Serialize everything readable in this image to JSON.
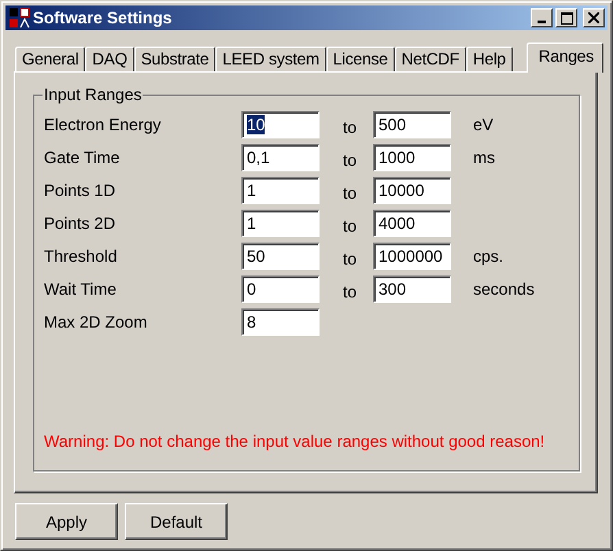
{
  "window": {
    "title": "Software Settings"
  },
  "tabs": [
    {
      "label": "General",
      "selected": false
    },
    {
      "label": "DAQ",
      "selected": false
    },
    {
      "label": "Substrate",
      "selected": false
    },
    {
      "label": "LEED system",
      "selected": false
    },
    {
      "label": "License",
      "selected": false
    },
    {
      "label": "NetCDF",
      "selected": false
    },
    {
      "label": "Help",
      "selected": false
    },
    {
      "label": "Ranges",
      "selected": true
    }
  ],
  "group": {
    "title": "Input Ranges",
    "rows": [
      {
        "label": "Electron Energy",
        "min": "10",
        "min_focused": true,
        "to": "to",
        "max": "500",
        "unit": "eV"
      },
      {
        "label": "Gate Time",
        "min": "0,1",
        "min_focused": false,
        "to": "to",
        "max": "1000",
        "unit": "ms"
      },
      {
        "label": "Points 1D",
        "min": "1",
        "min_focused": false,
        "to": "to",
        "max": "10000"
      },
      {
        "label": "Points 2D",
        "min": "1",
        "min_focused": false,
        "to": "to",
        "max": "4000"
      },
      {
        "label": "Threshold",
        "min": "50",
        "min_focused": false,
        "to": "to",
        "max": "1000000",
        "unit": "cps."
      },
      {
        "label": "Wait Time",
        "min": "0",
        "min_focused": false,
        "to": "to",
        "max": "300",
        "unit": "seconds"
      },
      {
        "label": "Max 2D Zoom",
        "min": "8",
        "min_focused": false
      }
    ],
    "warning": "Warning: Do not change the input value ranges without good reason!"
  },
  "buttons": [
    "Apply",
    "Default"
  ]
}
